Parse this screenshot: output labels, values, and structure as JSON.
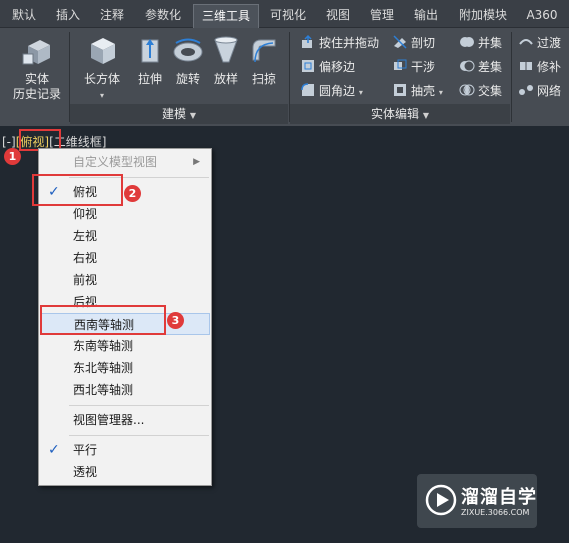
{
  "tabs": [
    "默认",
    "插入",
    "注释",
    "参数化",
    "三维工具",
    "可视化",
    "视图",
    "管理",
    "输出",
    "附加模块",
    "A360"
  ],
  "active_tab": "三维工具",
  "ribbon": {
    "history": {
      "line1": "实体",
      "line2": "历史记录"
    },
    "modeling": {
      "box": "长方体",
      "extrude": "拉伸",
      "revolve": "旋转",
      "loft": "放样",
      "sweep": "扫掠",
      "panel_title": "建模"
    },
    "solid_edit": {
      "presspull": "按住并拖动",
      "offset_edge": "偏移边",
      "fillet_edge": "圆角边",
      "slice": "剖切",
      "interfere": "干涉",
      "shell": "抽壳",
      "union": "并集",
      "subtract": "差集",
      "intersect": "交集",
      "panel_title": "实体编辑"
    },
    "mesh": {
      "smooth": "过渡",
      "repair": "修补",
      "network": "网络"
    }
  },
  "viewport_controls": {
    "open": "[-]",
    "view": "[俯视]",
    "style": "[二维线框]"
  },
  "menu": {
    "custom": "自定义模型视图",
    "items": [
      "俯视",
      "仰视",
      "左视",
      "右视",
      "前视",
      "后视",
      "西南等轴测",
      "东南等轴测",
      "东北等轴测",
      "西北等轴测"
    ],
    "manager": "视图管理器...",
    "parallel": "平行",
    "perspective": "透视"
  },
  "badges": [
    "1",
    "2",
    "3"
  ],
  "watermark": {
    "title": "溜溜自学",
    "sub": "ZIXUE.3066.COM"
  },
  "colors": {
    "accent": "#e03a3a",
    "check": "#1e5fbf"
  }
}
